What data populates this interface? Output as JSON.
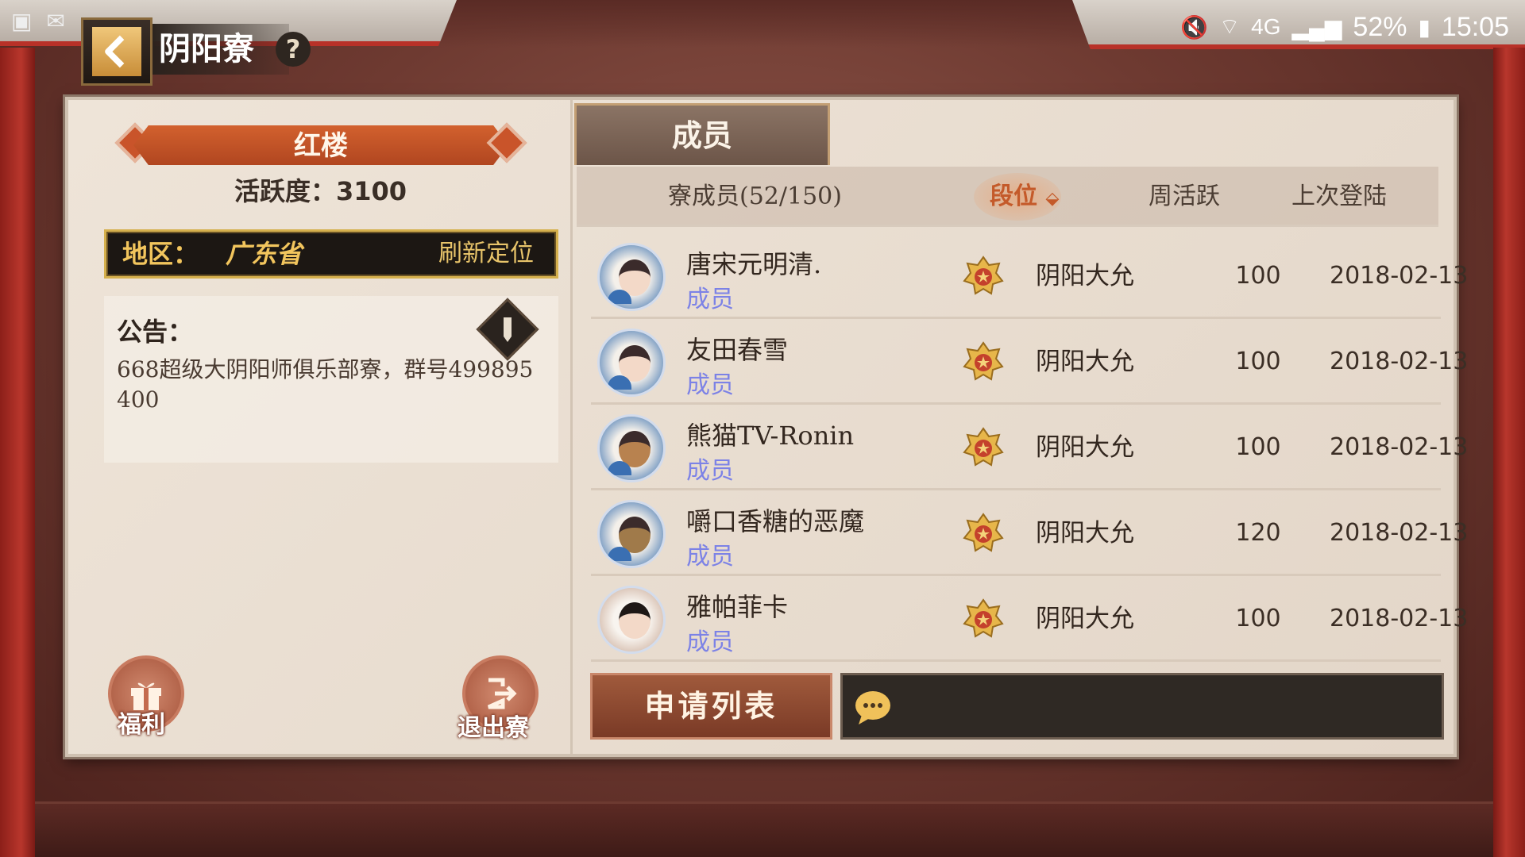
{
  "status_bar": {
    "battery_percent": "52%",
    "time": "15:05",
    "network": "4G"
  },
  "header": {
    "title": "阴阳寮",
    "help_label": "?"
  },
  "guild": {
    "name": "红楼",
    "activity": "活跃度：3100",
    "region_label": "地区：",
    "region_value": "广东省",
    "refresh_label": "刷新定位",
    "notice_title": "公告：",
    "notice_body": "668超级大阴阳师俱乐部寮，群号499895400"
  },
  "actions": {
    "welfare_label": "福利",
    "leave_label": "退出寮",
    "apply_list_label": "申请列表"
  },
  "tabs": {
    "members_label": "成员"
  },
  "table": {
    "headers": {
      "members": "寮成员(52/150)",
      "rank": "段位",
      "weekly": "周活跃",
      "last_login": "上次登陆"
    },
    "rows": [
      {
        "name": "唐宋元明清.",
        "role": "成员",
        "rank": "阴阳大允",
        "weekly": "100",
        "last_login": "2018-02-13"
      },
      {
        "name": "友田春雪",
        "role": "成员",
        "rank": "阴阳大允",
        "weekly": "100",
        "last_login": "2018-02-13"
      },
      {
        "name": "熊猫TV-Ronin",
        "role": "成员",
        "rank": "阴阳大允",
        "weekly": "100",
        "last_login": "2018-02-13"
      },
      {
        "name": "嚼口香糖的恶魔",
        "role": "成员",
        "rank": "阴阳大允",
        "weekly": "120",
        "last_login": "2018-02-13"
      },
      {
        "name": "雅帕菲卡",
        "role": "成员",
        "rank": "阴阳大允",
        "weekly": "100",
        "last_login": "2018-02-13"
      }
    ]
  },
  "icons": {
    "back": "back-arrow-icon",
    "help": "help-icon",
    "edit": "pencil-icon",
    "welfare": "gift-icon",
    "leave": "exit-icon",
    "chat": "chat-bubble-icon",
    "rank": "rank-star-badge-icon",
    "sort": "sort-down-icon"
  },
  "colors": {
    "accent_orange": "#c45a2a",
    "role_blue": "#7c82e6",
    "region_gold": "#f2c55d",
    "pillar_red": "#b8362c"
  }
}
